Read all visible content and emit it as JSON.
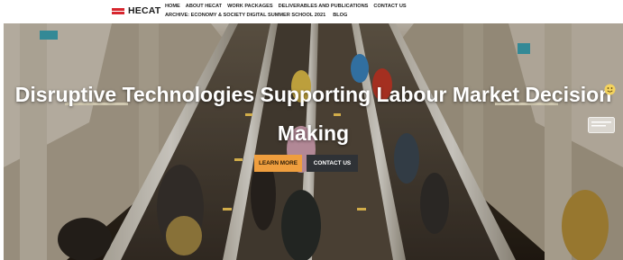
{
  "header": {
    "logo_text": "HECAT",
    "nav_row1": [
      "HOME",
      "ABOUT HECAT",
      "WORK PACKAGES",
      "DELIVERABLES AND PUBLICATIONS",
      "CONTACT US"
    ],
    "nav_row2": [
      "ARCHIVE: ECONOMY & SOCIETY DIGITAL SUMMER SCHOOL 2021",
      "BLOG"
    ]
  },
  "hero": {
    "title_line1": "Disruptive Technologies Supporting Labour Market Decision",
    "title_line2": "Making",
    "learn_more_label": "LEARN MORE",
    "contact_label": "CONTACT US"
  },
  "colors": {
    "accent": "#ef9e3e",
    "dark_button": "#2f3236",
    "brand_red": "#d7262e"
  },
  "icons": [
    "hecat-flag-logo-icon",
    "smiley-icon",
    "chat-icon"
  ]
}
